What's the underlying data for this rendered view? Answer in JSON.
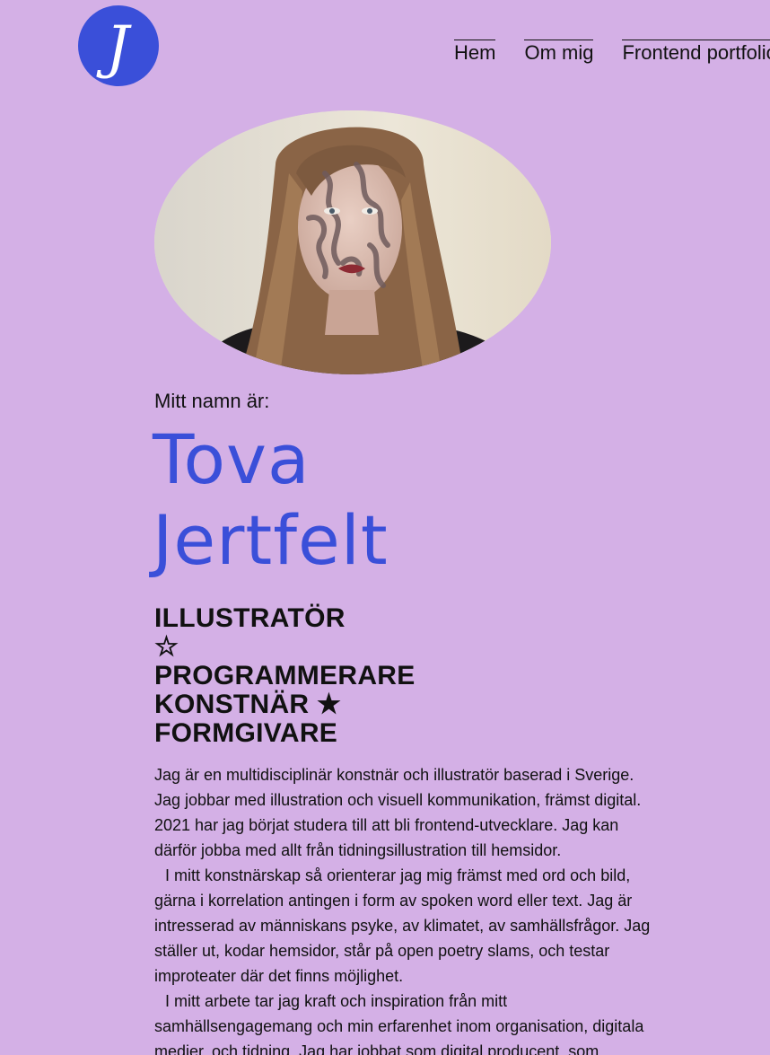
{
  "header": {
    "logo_letter": "J",
    "nav": [
      {
        "label": "Hem"
      },
      {
        "label": "Om mig"
      },
      {
        "label": "Frontend portfolio"
      }
    ]
  },
  "hero": {
    "intro": "Mitt namn är:",
    "first_name": "Tova",
    "last_name": "Jertfelt"
  },
  "roles": [
    "ILLUSTRATÖR",
    "☆",
    "PROGRAMMERARE",
    "KONSTNÄR ★",
    "FORMGIVARE"
  ],
  "bio": [
    "Jag är en multidisciplinär konstnär och illustratör baserad i Sverige. Jag jobbar med illustration och visuell kommunikation, främst digital. 2021 har jag börjat studera till att bli frontend-utvecklare. Jag kan därför jobba med allt från tidningsillustration till hemsidor.",
    "I mitt konstnärskap så orienterar jag mig främst med ord och bild, gärna i korrelation antingen i form av spoken word eller text. Jag är intresserad av människans psyke, av klimatet, av samhällsfrågor. Jag ställer ut, kodar hemsidor, står på open poetry slams, och testar improteater där det finns möjlighet.",
    "I mitt arbete tar jag kraft och inspiration från mitt samhällsengagemang och min erfarenhet inom organisation, digitala medier, och tidning. Jag har jobbat som digital producent, som"
  ],
  "colors": {
    "background": "#d4b0e6",
    "accent": "#3a4fd9",
    "text": "#111111"
  }
}
